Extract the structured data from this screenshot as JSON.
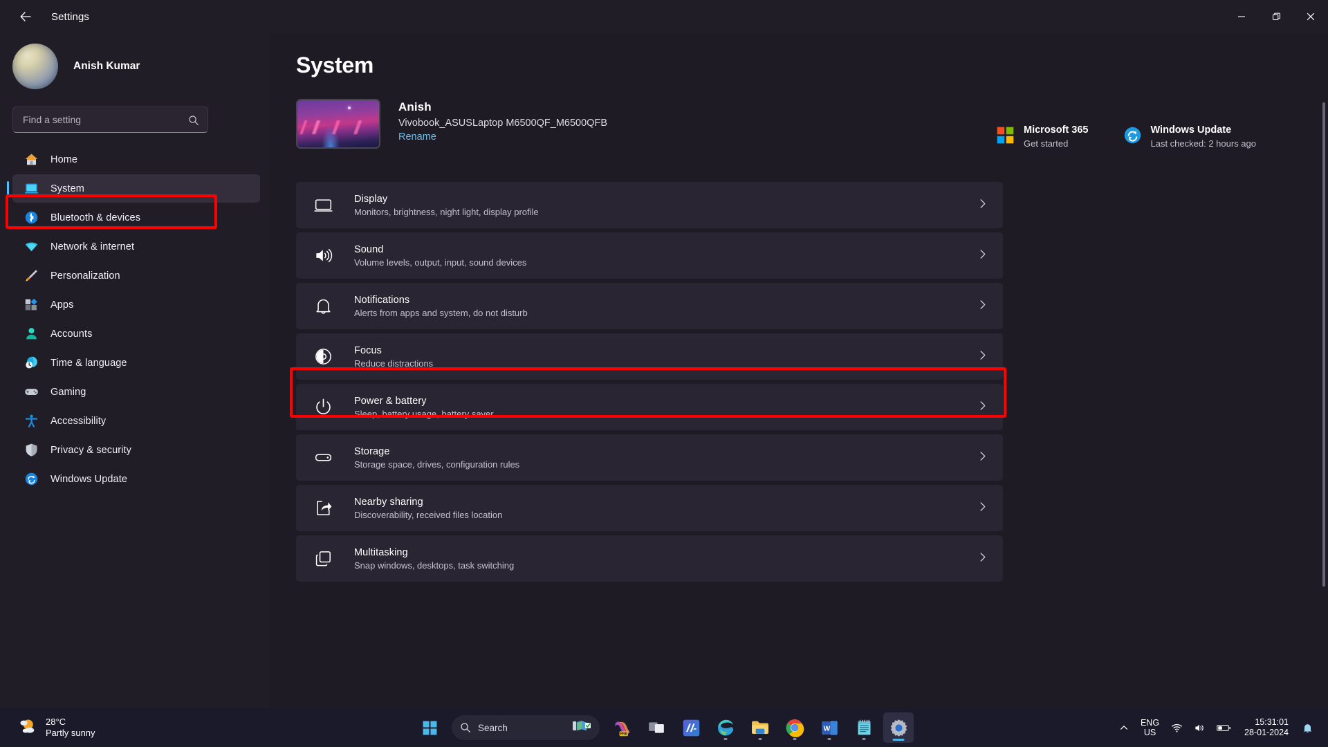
{
  "window": {
    "title": "Settings",
    "back_icon": "back-arrow-icon",
    "minimize_label": "Minimize",
    "maximize_label": "Restore",
    "close_label": "Close"
  },
  "sidebar": {
    "profile_name": "Anish Kumar",
    "search_placeholder": "Find a setting",
    "search_value": "",
    "items": [
      {
        "label": "Home",
        "icon": "home-icon"
      },
      {
        "label": "System",
        "icon": "system-icon"
      },
      {
        "label": "Bluetooth & devices",
        "icon": "bluetooth-icon"
      },
      {
        "label": "Network & internet",
        "icon": "wifi-icon"
      },
      {
        "label": "Personalization",
        "icon": "paintbrush-icon"
      },
      {
        "label": "Apps",
        "icon": "apps-icon"
      },
      {
        "label": "Accounts",
        "icon": "account-icon"
      },
      {
        "label": "Time & language",
        "icon": "clock-globe-icon"
      },
      {
        "label": "Gaming",
        "icon": "gamepad-icon"
      },
      {
        "label": "Accessibility",
        "icon": "accessibility-icon"
      },
      {
        "label": "Privacy & security",
        "icon": "shield-icon"
      },
      {
        "label": "Windows Update",
        "icon": "update-icon"
      }
    ],
    "active_index": 1
  },
  "main": {
    "page_title": "System",
    "device": {
      "name": "Anish",
      "model": "Vivobook_ASUSLaptop M6500QF_M6500QFB",
      "rename_label": "Rename"
    },
    "header_cards": [
      {
        "title": "Microsoft 365",
        "subtitle": "Get started",
        "icon": "microsoft-logo-icon"
      },
      {
        "title": "Windows Update",
        "subtitle": "Last checked: 2 hours ago",
        "icon": "update-icon"
      }
    ],
    "rows": [
      {
        "title": "Display",
        "subtitle": "Monitors, brightness, night light, display profile",
        "icon": "monitor-icon"
      },
      {
        "title": "Sound",
        "subtitle": "Volume levels, output, input, sound devices",
        "icon": "speaker-icon"
      },
      {
        "title": "Notifications",
        "subtitle": "Alerts from apps and system, do not disturb",
        "icon": "bell-icon"
      },
      {
        "title": "Focus",
        "subtitle": "Reduce distractions",
        "icon": "focus-icon"
      },
      {
        "title": "Power & battery",
        "subtitle": "Sleep, battery usage, battery saver",
        "icon": "power-icon"
      },
      {
        "title": "Storage",
        "subtitle": "Storage space, drives, configuration rules",
        "icon": "storage-icon"
      },
      {
        "title": "Nearby sharing",
        "subtitle": "Discoverability, received files location",
        "icon": "share-icon"
      },
      {
        "title": "Multitasking",
        "subtitle": "Snap windows, desktops, task switching",
        "icon": "multitasking-icon"
      }
    ],
    "highlighted_row_index": 4
  },
  "taskbar": {
    "weather": {
      "temperature": "28°C",
      "condition": "Partly sunny",
      "icon": "partly-sunny-icon"
    },
    "start_label": "Start",
    "search_placeholder": "Search",
    "apps": [
      {
        "name": "News and Interests",
        "icon": "news-widget-icon"
      },
      {
        "name": "Copilot Preview",
        "icon": "copilot-icon"
      },
      {
        "name": "Task View",
        "icon": "task-view-icon"
      },
      {
        "name": "MyASUS",
        "icon": "myasus-icon"
      },
      {
        "name": "Microsoft Edge",
        "icon": "edge-icon"
      },
      {
        "name": "File Explorer",
        "icon": "file-explorer-icon"
      },
      {
        "name": "Google Chrome",
        "icon": "chrome-icon"
      },
      {
        "name": "Microsoft Word",
        "icon": "word-icon"
      },
      {
        "name": "Sticky Notes",
        "icon": "notepad-icon"
      },
      {
        "name": "Settings",
        "icon": "settings-gear-icon"
      }
    ],
    "tray": {
      "chevron_label": "Show hidden icons",
      "language_line1": "ENG",
      "language_line2": "US",
      "wifi_icon": "wifi-icon",
      "volume_icon": "speaker-icon",
      "battery_icon": "battery-icon",
      "time": "15:31:01",
      "date": "28-01-2024",
      "notification_icon": "bell-icon"
    }
  },
  "colors": {
    "accent": "#4cc2ff",
    "annotation": "#ff0000",
    "link": "#6fbfe8",
    "window_bg": "#1f1b24",
    "sidebar_bg": "#211d27",
    "card_bg": "#2a2532"
  }
}
